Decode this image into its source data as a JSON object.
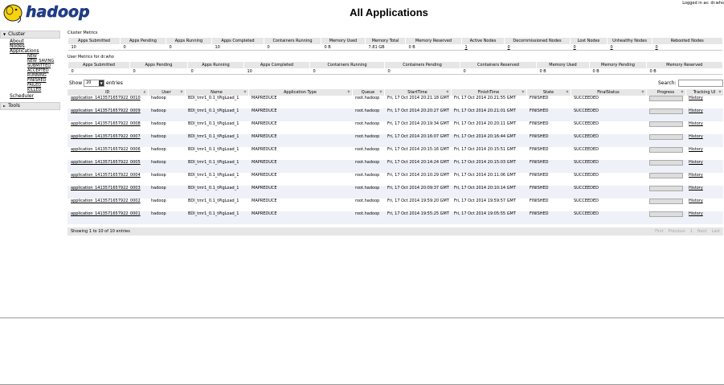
{
  "header": {
    "logo_text": "hadoop",
    "title": "All Applications",
    "logged_in": "Logged in as: dr.who"
  },
  "sidebar": {
    "cluster_label": "Cluster",
    "items": [
      "About",
      "Nodes",
      "Applications"
    ],
    "app_states": [
      "NEW",
      "NEW_SAVING",
      "SUBMITTED",
      "ACCEPTED",
      "RUNNING",
      "FINISHED",
      "FAILED",
      "KILLED"
    ],
    "scheduler": "Scheduler",
    "tools_label": "Tools"
  },
  "cluster_metrics": {
    "label": "Cluster Metrics",
    "headers": [
      "Apps Submitted",
      "Apps Pending",
      "Apps Running",
      "Apps Completed",
      "Containers Running",
      "Memory Used",
      "Memory Total",
      "Memory Reserved",
      "Active Nodes",
      "Decommissioned Nodes",
      "Lost Nodes",
      "Unhealthy Nodes",
      "Rebooted Nodes"
    ],
    "values": [
      "10",
      "0",
      "0",
      "10",
      "0",
      "0 B",
      "7.81 GB",
      "0 B",
      "1",
      "0",
      "0",
      "0",
      "0"
    ]
  },
  "user_metrics": {
    "label": "User Metrics for dr.who",
    "headers": [
      "Apps Submitted",
      "Apps Pending",
      "Apps Running",
      "Apps Completed",
      "Containers Running",
      "Containers Pending",
      "Containers Reserved",
      "Memory Used",
      "Memory Pending",
      "Memory Reserved"
    ],
    "values": [
      "0",
      "0",
      "0",
      "10",
      "0",
      "0",
      "0",
      "0 B",
      "0 B",
      "0 B"
    ]
  },
  "apps_table": {
    "show_label": "Show",
    "entries_count": "20",
    "entries_label": "entries",
    "search_label": "Search:",
    "columns": [
      "ID",
      "User",
      "Name",
      "Application Type",
      "Queue",
      "StartTime",
      "FinishTime",
      "State",
      "FinalStatus",
      "Progress",
      "Tracking UI"
    ],
    "rows": [
      {
        "id": "application_1413571657922_0010",
        "user": "hadoop",
        "name": "BDI_tmr1_0.1_tPigLoad_1",
        "type": "MAPREDUCE",
        "queue": "root.hadoop",
        "start": "Fri, 17 Oct 2014 20:21:18 GMT",
        "finish": "Fri, 17 Oct 2014 20:21:55 GMT",
        "state": "FINISHED",
        "final": "SUCCEEDED",
        "tracking": "History"
      },
      {
        "id": "application_1413571657922_0009",
        "user": "hadoop",
        "name": "BDI_tmr1_0.1_tPigLoad_1",
        "type": "MAPREDUCE",
        "queue": "root.hadoop",
        "start": "Fri, 17 Oct 2014 20:20:27 GMT",
        "finish": "Fri, 17 Oct 2014 20:21:01 GMT",
        "state": "FINISHED",
        "final": "SUCCEEDED",
        "tracking": "History"
      },
      {
        "id": "application_1413571657922_0008",
        "user": "hadoop",
        "name": "BDI_tmr1_0.1_tPigLoad_1",
        "type": "MAPREDUCE",
        "queue": "root.hadoop",
        "start": "Fri, 17 Oct 2014 20:19:34 GMT",
        "finish": "Fri, 17 Oct 2014 20:20:11 GMT",
        "state": "FINISHED",
        "final": "SUCCEEDED",
        "tracking": "History"
      },
      {
        "id": "application_1413571657922_0007",
        "user": "hadoop",
        "name": "BDI_tmr1_0.1_tPigLoad_1",
        "type": "MAPREDUCE",
        "queue": "root.hadoop",
        "start": "Fri, 17 Oct 2014 20:16:07 GMT",
        "finish": "Fri, 17 Oct 2014 20:16:44 GMT",
        "state": "FINISHED",
        "final": "SUCCEEDED",
        "tracking": "History"
      },
      {
        "id": "application_1413571657922_0006",
        "user": "hadoop",
        "name": "BDI_tmr1_0.1_tPigLoad_1",
        "type": "MAPREDUCE",
        "queue": "root.hadoop",
        "start": "Fri, 17 Oct 2014 20:15:16 GMT",
        "finish": "Fri, 17 Oct 2014 20:15:51 GMT",
        "state": "FINISHED",
        "final": "SUCCEEDED",
        "tracking": "History"
      },
      {
        "id": "application_1413571657922_0005",
        "user": "hadoop",
        "name": "BDI_tmr1_0.1_tPigLoad_1",
        "type": "MAPREDUCE",
        "queue": "root.hadoop",
        "start": "Fri, 17 Oct 2014 20:14:24 GMT",
        "finish": "Fri, 17 Oct 2014 20:15:03 GMT",
        "state": "FINISHED",
        "final": "SUCCEEDED",
        "tracking": "History"
      },
      {
        "id": "application_1413571657922_0004",
        "user": "hadoop",
        "name": "BDI_tmr1_0.1_tPigLoad_1",
        "type": "MAPREDUCE",
        "queue": "root.hadoop",
        "start": "Fri, 17 Oct 2014 20:10:29 GMT",
        "finish": "Fri, 17 Oct 2014 20:11:06 GMT",
        "state": "FINISHED",
        "final": "SUCCEEDED",
        "tracking": "History"
      },
      {
        "id": "application_1413571657922_0003",
        "user": "hadoop",
        "name": "BDI_tmr1_0.1_tPigLoad_1",
        "type": "MAPREDUCE",
        "queue": "root.hadoop",
        "start": "Fri, 17 Oct 2014 20:09:37 GMT",
        "finish": "Fri, 17 Oct 2014 20:10:14 GMT",
        "state": "FINISHED",
        "final": "SUCCEEDED",
        "tracking": "History"
      },
      {
        "id": "application_1413571657922_0002",
        "user": "hadoop",
        "name": "BDI_tmr1_0.1_tPigLoad_1",
        "type": "MAPREDUCE",
        "queue": "root.hadoop",
        "start": "Fri, 17 Oct 2014 19:59:20 GMT",
        "finish": "Fri, 17 Oct 2014 19:59:57 GMT",
        "state": "FINISHED",
        "final": "SUCCEEDED",
        "tracking": "History"
      },
      {
        "id": "application_1413571657922_0001",
        "user": "hadoop",
        "name": "BDI_tmr1_0.1_tPigLoad_1",
        "type": "MAPREDUCE",
        "queue": "root.hadoop",
        "start": "Fri, 17 Oct 2014 19:55:25 GMT",
        "finish": "Fri, 17 Oct 2014 19:05:55 GMT",
        "state": "FINISHED",
        "final": "SUCCEEDED",
        "tracking": "History"
      }
    ],
    "footer_info": "Showing 1 to 10 of 10 entries",
    "pager": [
      "First",
      "Previous",
      "1",
      "Next",
      "Last"
    ]
  },
  "colors": {
    "header_gray": "#e6e6e6",
    "even_row": "#eef1f8",
    "logo_yellow": "#f6d30c"
  }
}
